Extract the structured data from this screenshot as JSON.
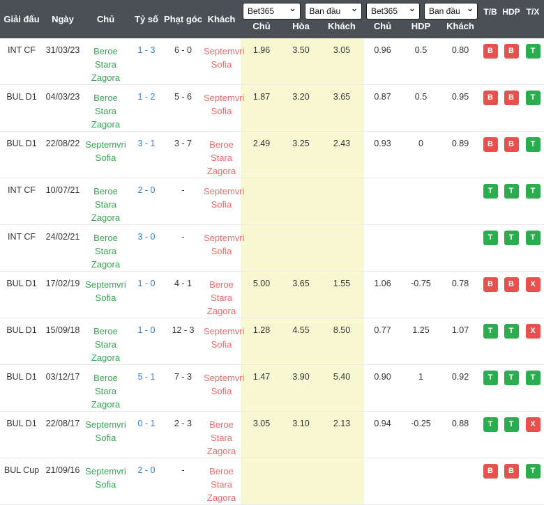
{
  "colors": {
    "header_bg": "#4b5056",
    "home_team": "#36a452",
    "away_team": "#ef6a6a",
    "score_link": "#2d7cd8",
    "odds_bg": "#f8f9d2",
    "badge_red": "#e8504e",
    "badge_green": "#2bad4f"
  },
  "header": {
    "static_cols": [
      "Giải đấu",
      "Ngày",
      "Chủ",
      "Tỷ số",
      "Phạt góc",
      "Khách"
    ],
    "selects": [
      {
        "value": "Bet365"
      },
      {
        "value": "Ban đầu"
      },
      {
        "value": "Bet365"
      },
      {
        "value": "Ban đầu"
      }
    ],
    "odds_1x2_cols": [
      "Chủ",
      "Hòa",
      "Khách"
    ],
    "odds_hdp_cols": [
      "Chủ",
      "HDP",
      "Khách"
    ],
    "result_cols": [
      "T/B",
      "HDP",
      "T/X"
    ],
    "caret_icon": "⌄"
  },
  "rows": [
    {
      "league": "INT CF",
      "date": "31/03/23",
      "home": "Beroe Stara Zagora",
      "score": "1 - 3",
      "corners": "6 - 0",
      "away": "Septemvri Sofia",
      "odds_1x2": [
        "1.96",
        "3.50",
        "3.05"
      ],
      "odds_hdp": [
        "0.96",
        "0.5",
        "0.80"
      ],
      "badges": [
        {
          "label": "B",
          "color": "red"
        },
        {
          "label": "B",
          "color": "red"
        },
        {
          "label": "T",
          "color": "green"
        }
      ]
    },
    {
      "league": "BUL D1",
      "date": "04/03/23",
      "home": "Beroe Stara Zagora",
      "score": "1 - 2",
      "corners": "5 - 6",
      "away": "Septemvri Sofia",
      "odds_1x2": [
        "1.87",
        "3.20",
        "3.65"
      ],
      "odds_hdp": [
        "0.87",
        "0.5",
        "0.95"
      ],
      "badges": [
        {
          "label": "B",
          "color": "red"
        },
        {
          "label": "B",
          "color": "red"
        },
        {
          "label": "T",
          "color": "green"
        }
      ]
    },
    {
      "league": "BUL D1",
      "date": "22/08/22",
      "home": "Septemvri Sofia",
      "score": "3 - 1",
      "corners": "3 - 7",
      "away": "Beroe Stara Zagora",
      "odds_1x2": [
        "2.49",
        "3.25",
        "2.43"
      ],
      "odds_hdp": [
        "0.93",
        "0",
        "0.89"
      ],
      "badges": [
        {
          "label": "B",
          "color": "red"
        },
        {
          "label": "B",
          "color": "red"
        },
        {
          "label": "T",
          "color": "green"
        }
      ]
    },
    {
      "league": "INT CF",
      "date": "10/07/21",
      "home": "Beroe Stara Zagora",
      "score": "2 - 0",
      "corners": "-",
      "away": "Septemvri Sofia",
      "odds_1x2": [
        "",
        "",
        ""
      ],
      "odds_hdp": [
        "",
        "",
        ""
      ],
      "badges": [
        {
          "label": "T",
          "color": "green"
        },
        {
          "label": "T",
          "color": "green"
        },
        {
          "label": "T",
          "color": "green"
        }
      ]
    },
    {
      "league": "INT CF",
      "date": "24/02/21",
      "home": "Beroe Stara Zagora",
      "score": "3 - 0",
      "corners": "-",
      "away": "Septemvri Sofia",
      "odds_1x2": [
        "",
        "",
        ""
      ],
      "odds_hdp": [
        "",
        "",
        ""
      ],
      "badges": [
        {
          "label": "T",
          "color": "green"
        },
        {
          "label": "T",
          "color": "green"
        },
        {
          "label": "T",
          "color": "green"
        }
      ]
    },
    {
      "league": "BUL D1",
      "date": "17/02/19",
      "home": "Septemvri Sofia",
      "score": "1 - 0",
      "corners": "4 - 1",
      "away": "Beroe Stara Zagora",
      "odds_1x2": [
        "5.00",
        "3.65",
        "1.55"
      ],
      "odds_hdp": [
        "1.06",
        "-0.75",
        "0.78"
      ],
      "badges": [
        {
          "label": "B",
          "color": "red"
        },
        {
          "label": "B",
          "color": "red"
        },
        {
          "label": "X",
          "color": "red"
        }
      ]
    },
    {
      "league": "BUL D1",
      "date": "15/09/18",
      "home": "Beroe Stara Zagora",
      "score": "1 - 0",
      "corners": "12 - 3",
      "away": "Septemvri Sofia",
      "odds_1x2": [
        "1.28",
        "4.55",
        "8.50"
      ],
      "odds_hdp": [
        "0.77",
        "1.25",
        "1.07"
      ],
      "badges": [
        {
          "label": "T",
          "color": "green"
        },
        {
          "label": "T",
          "color": "green"
        },
        {
          "label": "X",
          "color": "red"
        }
      ]
    },
    {
      "league": "BUL D1",
      "date": "03/12/17",
      "home": "Beroe Stara Zagora",
      "score": "5 - 1",
      "corners": "7 - 3",
      "away": "Septemvri Sofia",
      "odds_1x2": [
        "1.47",
        "3.90",
        "5.40"
      ],
      "odds_hdp": [
        "0.90",
        "1",
        "0.92"
      ],
      "badges": [
        {
          "label": "T",
          "color": "green"
        },
        {
          "label": "T",
          "color": "green"
        },
        {
          "label": "T",
          "color": "green"
        }
      ]
    },
    {
      "league": "BUL D1",
      "date": "22/08/17",
      "home": "Septemvri Sofia",
      "score": "0 - 1",
      "corners": "2 - 3",
      "away": "Beroe Stara Zagora",
      "odds_1x2": [
        "3.05",
        "3.10",
        "2.13"
      ],
      "odds_hdp": [
        "0.94",
        "-0.25",
        "0.88"
      ],
      "badges": [
        {
          "label": "T",
          "color": "green"
        },
        {
          "label": "T",
          "color": "green"
        },
        {
          "label": "X",
          "color": "red"
        }
      ]
    },
    {
      "league": "BUL Cup",
      "date": "21/09/16",
      "home": "Septemvri Sofia",
      "score": "2 - 0",
      "corners": "-",
      "away": "Beroe Stara Zagora",
      "odds_1x2": [
        "",
        "",
        ""
      ],
      "odds_hdp": [
        "",
        "",
        ""
      ],
      "badges": [
        {
          "label": "B",
          "color": "red"
        },
        {
          "label": "B",
          "color": "red"
        },
        {
          "label": "T",
          "color": "green"
        }
      ]
    }
  ]
}
